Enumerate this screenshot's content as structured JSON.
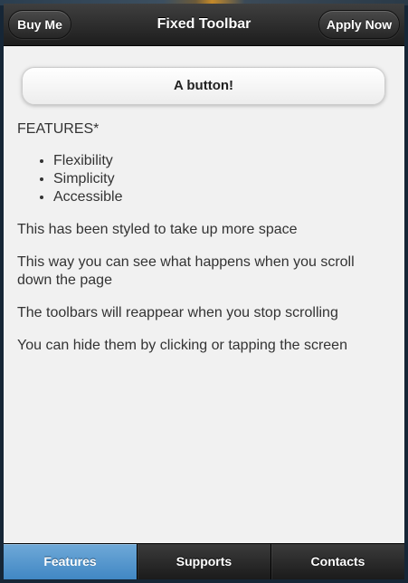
{
  "header": {
    "title": "Fixed Toolbar",
    "left_button": "Buy Me",
    "right_button": "Apply Now"
  },
  "content": {
    "button_label": "A button!",
    "features_title": "FEATURES*",
    "features": [
      "Flexibility",
      "Simplicity",
      "Accessible"
    ],
    "paragraphs": [
      "This has been styled to take up more space",
      "This way you can see what happens when you scroll down the page",
      "The toolbars will reappear when you stop scrolling",
      "You can hide them by clicking or tapping the screen"
    ]
  },
  "footer": {
    "tabs": [
      "Features",
      "Supports",
      "Contacts"
    ],
    "active_tab": "Features"
  },
  "colors": {
    "toolbar_dark": "#1d1d1d",
    "active_tab_blue": "#4b8fc8",
    "page_background": "#f1f1f1"
  }
}
